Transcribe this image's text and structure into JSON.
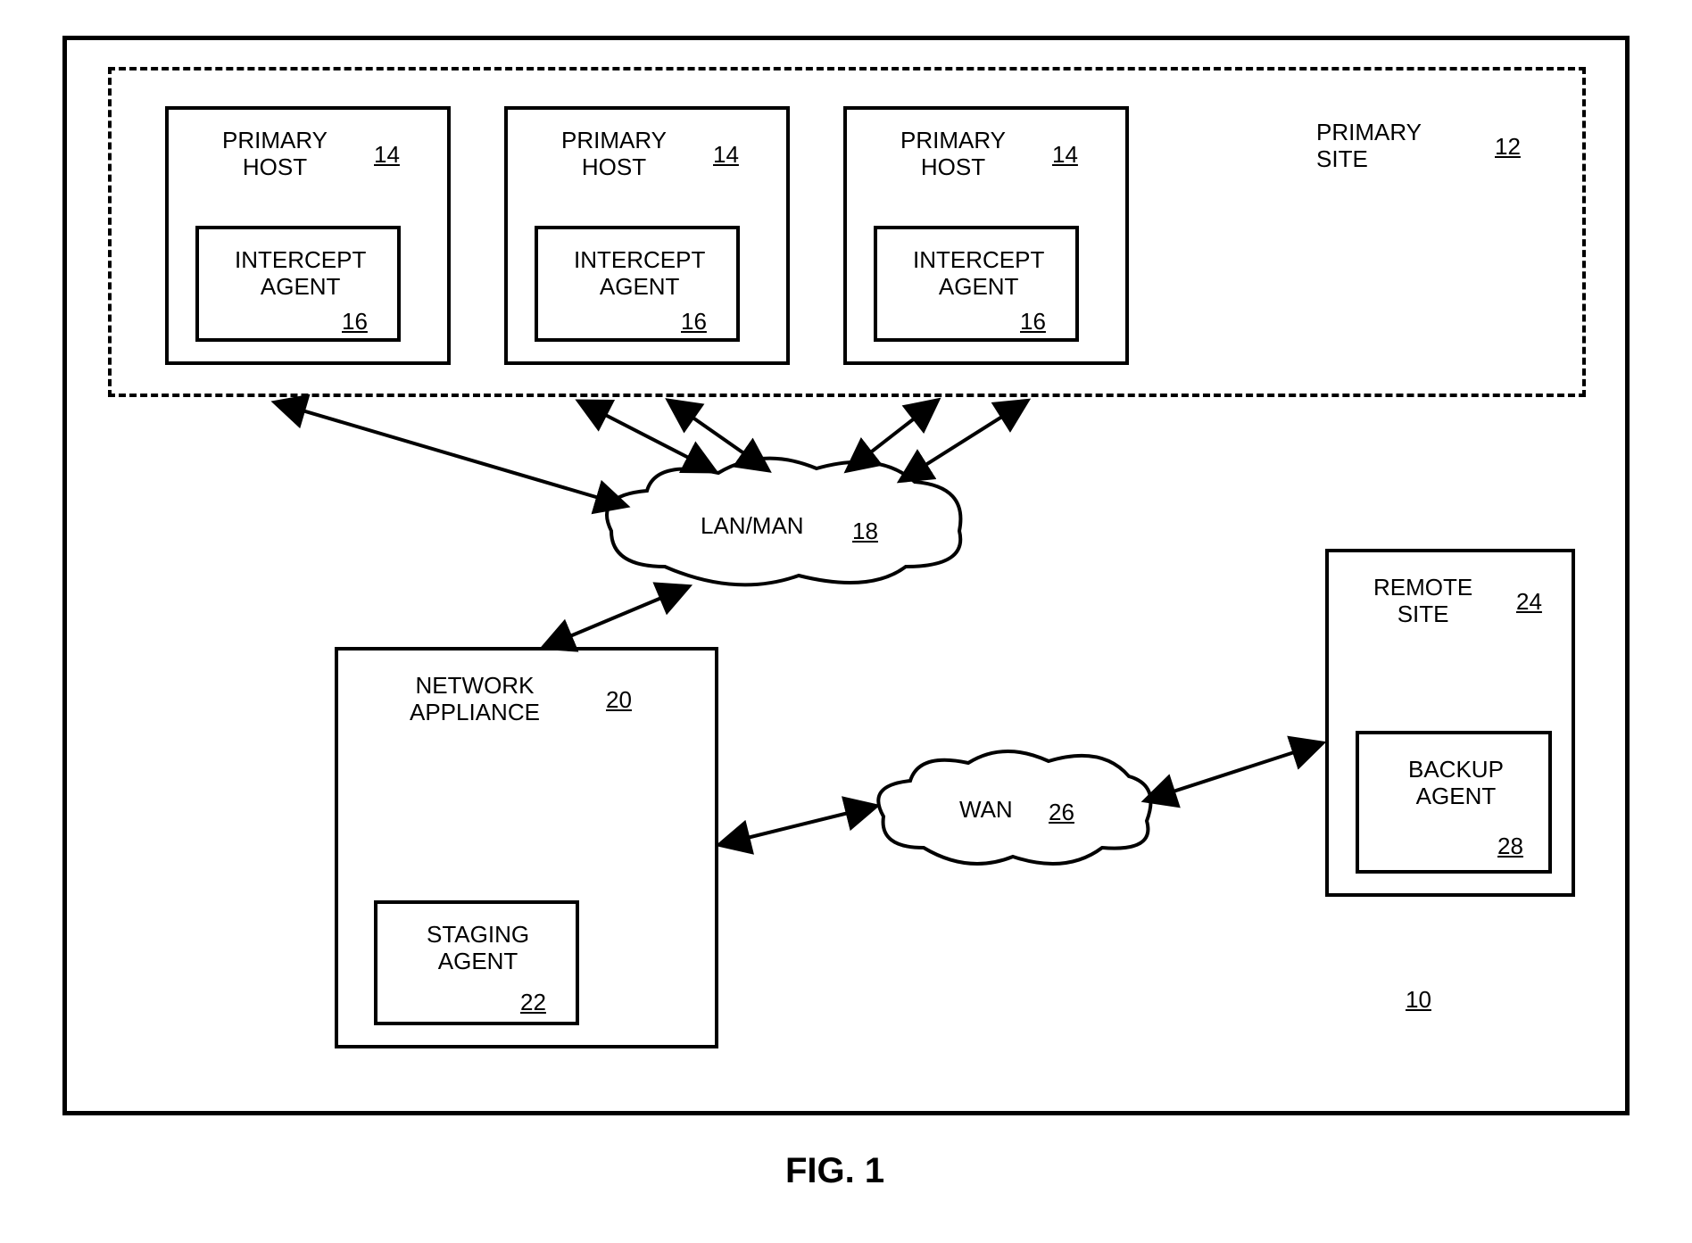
{
  "figure_label": "FIG. 1",
  "primary_site": {
    "label": "PRIMARY\nSITE",
    "ref": "12"
  },
  "hosts": {
    "host_label": "PRIMARY\nHOST",
    "host_ref": "14",
    "agent_label": "INTERCEPT\nAGENT",
    "agent_ref": "16"
  },
  "lan": {
    "label": "LAN/MAN",
    "ref": "18"
  },
  "appliance": {
    "label": "NETWORK\nAPPLIANCE",
    "ref": "20",
    "staging_label": "STAGING\nAGENT",
    "staging_ref": "22"
  },
  "wan": {
    "label": "WAN",
    "ref": "26"
  },
  "remote": {
    "label": "REMOTE\nSITE",
    "ref": "24",
    "backup_label": "BACKUP\nAGENT",
    "backup_ref": "28"
  },
  "overall_ref": "10"
}
